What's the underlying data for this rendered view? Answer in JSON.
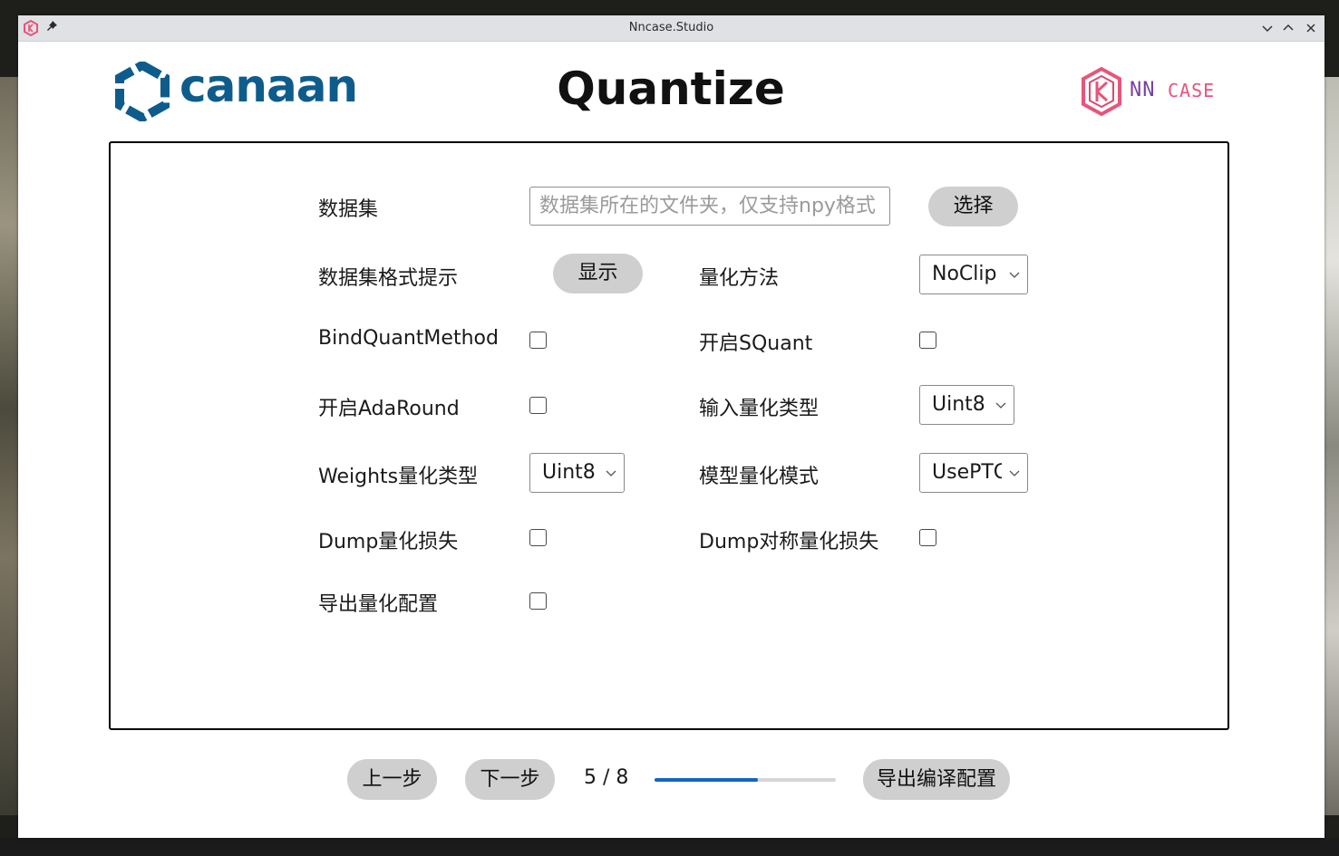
{
  "window": {
    "title": "Nncase.Studio"
  },
  "header": {
    "brand_left": "canaan",
    "page_title": "Quantize",
    "brand_right_nn": "NN",
    "brand_right_case": "CASE"
  },
  "form": {
    "dataset_label": "数据集",
    "dataset_placeholder": "数据集所在的文件夹，仅支持npy格式",
    "dataset_value": "",
    "select_button": "选择",
    "format_hint_label": "数据集格式提示",
    "show_button": "显示",
    "quant_method_label": "量化方法",
    "quant_method_value": "NoClip",
    "bind_quant_label": "BindQuantMethod",
    "bind_quant_checked": false,
    "squant_label": "开启SQuant",
    "squant_checked": false,
    "adaround_label": "开启AdaRound",
    "adaround_checked": false,
    "input_quant_type_label": "输入量化类型",
    "input_quant_type_value": "Uint8",
    "weights_quant_type_label": "Weights量化类型",
    "weights_quant_type_value": "Uint8",
    "model_quant_mode_label": "模型量化模式",
    "model_quant_mode_value": "UsePTQ",
    "dump_quant_error_label": "Dump量化损失",
    "dump_quant_error_checked": false,
    "dump_sym_quant_error_label": "Dump对称量化损失",
    "dump_sym_quant_error_checked": false,
    "export_quant_config_label": "导出量化配置",
    "export_quant_config_checked": false
  },
  "footer": {
    "prev_button": "上一步",
    "next_button": "下一步",
    "step_text": "5 / 8",
    "progress": 0.57,
    "export_button": "导出编译配置"
  },
  "colors": {
    "canaan_blue": "#0e5c8c",
    "nncase_pink": "#e8547a",
    "nncase_purple": "#7a3fa6",
    "progress_blue": "#1565c0",
    "pill_gray": "#cfcfcf"
  }
}
